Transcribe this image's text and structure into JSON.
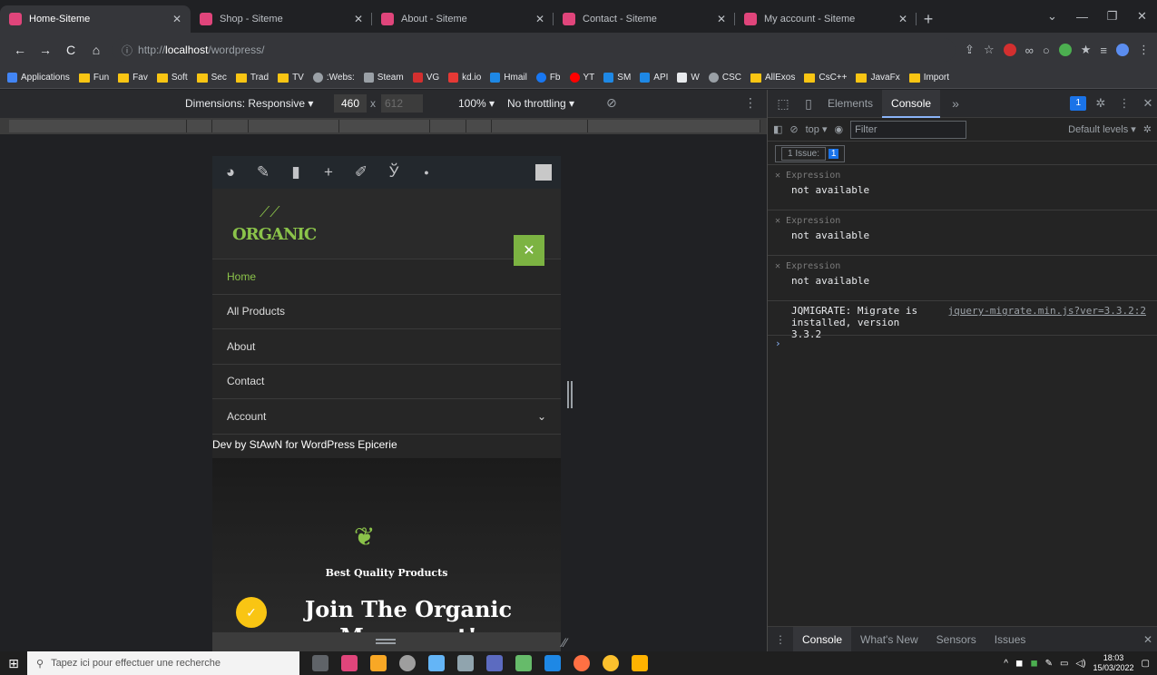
{
  "browser": {
    "tabs": [
      {
        "title": "Home-Siteme",
        "active": true
      },
      {
        "title": "Shop - Siteme",
        "active": false
      },
      {
        "title": "About - Siteme",
        "active": false
      },
      {
        "title": "Contact - Siteme",
        "active": false
      },
      {
        "title": "My account - Siteme",
        "active": false
      }
    ],
    "url_prefix": "http://",
    "url_host": "localhost",
    "url_path": "/wordpress/",
    "bookmarks": [
      "Applications",
      "Fun",
      "Fav",
      "Soft",
      "Sec",
      "Trad",
      "TV",
      ":Webs:",
      "Steam",
      "VG",
      "kd.io",
      "Hmail",
      "Fb",
      "YT",
      "SM",
      "API",
      "W",
      "CSC",
      "AllExos",
      "CsC++",
      "JavaFx",
      "Import"
    ]
  },
  "device_toolbar": {
    "dimensions": "Dimensions: Responsive ▾",
    "width": "460",
    "x": "x",
    "height": "612",
    "zoom": "100% ▾",
    "throttling": "No throttling ▾"
  },
  "site": {
    "logo": "ORGANIC",
    "menu": [
      {
        "label": "Home",
        "active": true
      },
      {
        "label": "All Products",
        "active": false
      },
      {
        "label": "About",
        "active": false
      },
      {
        "label": "Contact",
        "active": false
      },
      {
        "label": "Account",
        "active": false
      }
    ],
    "dev_by": "Dev by StAwN for WordPress Epicerie",
    "hero_subtitle": "Best Quality Products",
    "hero_title": "Join The Organic Movement!"
  },
  "devtools": {
    "tabs": [
      "Elements",
      "Console"
    ],
    "active_tab": "Console",
    "issues_count": "1",
    "context": "top ▾",
    "filter_placeholder": "Filter",
    "levels": "Default levels ▾",
    "issues_label": "1 Issue:",
    "issues_badge": "1",
    "expressions": [
      {
        "label": "Expression",
        "value": "not available"
      },
      {
        "label": "Expression",
        "value": "not available"
      },
      {
        "label": "Expression",
        "value": "not available"
      }
    ],
    "log": {
      "text": "JQMIGRATE: Migrate is installed, version 3.3.2",
      "source": "jquery-migrate.min.js?ver=3.3.2:2"
    },
    "drawer_tabs": [
      "Console",
      "What's New",
      "Sensors",
      "Issues"
    ]
  },
  "taskbar": {
    "search_placeholder": "Tapez ici pour effectuer une recherche",
    "time": "18:03",
    "date": "15/03/2022"
  },
  "colors": {
    "accent": "#8bc34a",
    "devtools_blue": "#8ab4f8"
  }
}
